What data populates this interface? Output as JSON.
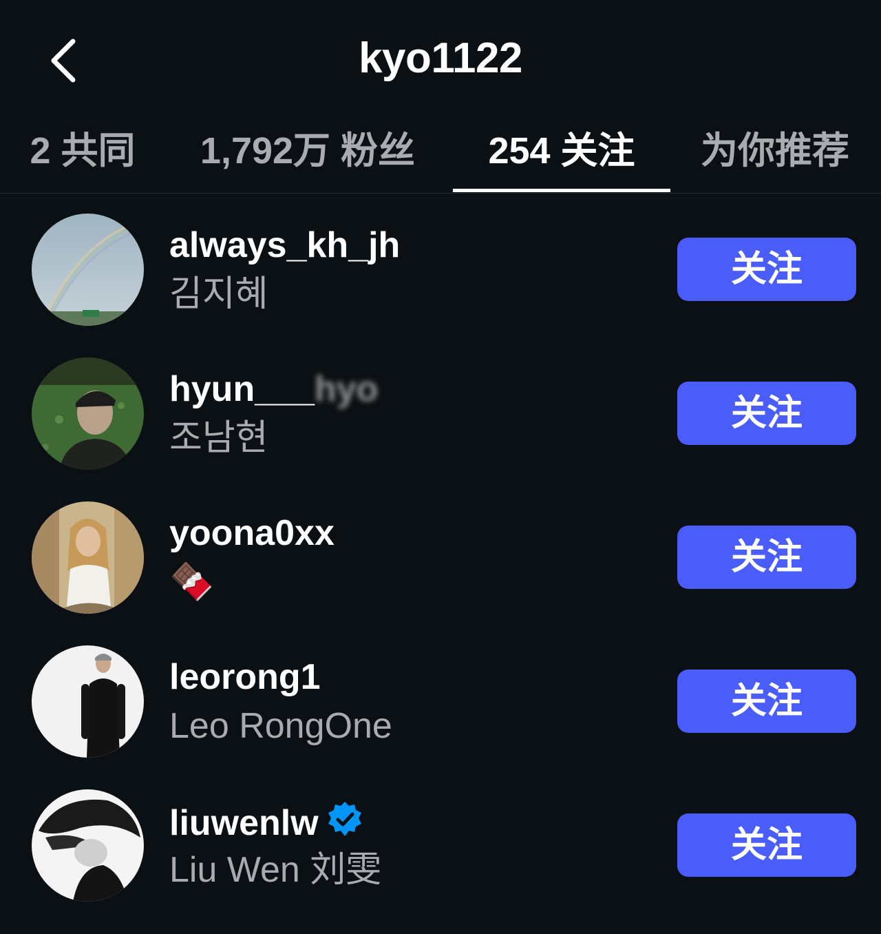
{
  "header": {
    "title": "kyo1122",
    "back_icon": "chevron-left-icon"
  },
  "tabs": [
    {
      "label": "2 共同",
      "active": false
    },
    {
      "label": "1,792万 粉丝",
      "active": false
    },
    {
      "label": "254 关注",
      "active": true
    },
    {
      "label": "为你推荐",
      "active": false
    }
  ],
  "colors": {
    "background": "#0b1014",
    "follow_button": "#4a5df9",
    "secondary_text": "#a8acb0",
    "verified_badge": "#0095f6"
  },
  "users": [
    {
      "username": "always_kh_jh",
      "fullname": "김지혜",
      "button": "关注",
      "avatar": "rainbow-sky-avatar"
    },
    {
      "username": "hyun___",
      "username_blurred": "hyo",
      "fullname": "조남현",
      "button": "关注",
      "avatar": "man-in-field-avatar"
    },
    {
      "username": "yoona0xx",
      "fullname": "🍫",
      "button": "关注",
      "avatar": "woman-smoking-avatar"
    },
    {
      "username": "leorong1",
      "fullname": "Leo RongOne",
      "button": "关注",
      "avatar": "man-black-sweater-avatar"
    },
    {
      "username": "liuwenlw",
      "fullname": "Liu Wen 刘雯",
      "button": "关注",
      "avatar": "woman-bw-portrait-avatar",
      "verified": true
    }
  ]
}
